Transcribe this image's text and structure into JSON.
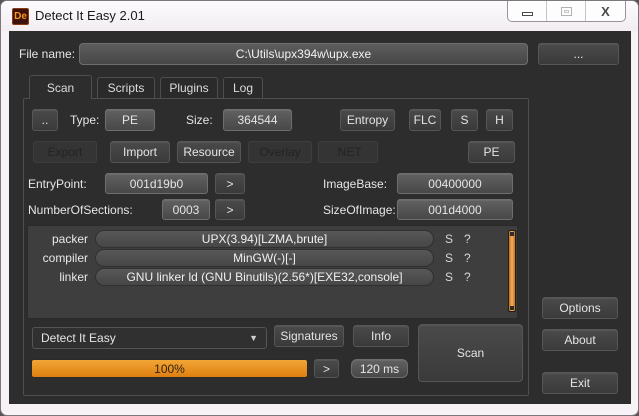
{
  "window": {
    "title": "Detect It Easy 2.01",
    "icon_glyph": "De"
  },
  "file_row": {
    "label": "File name:",
    "path": "C:\\Utils\\upx394w\\upx.exe",
    "browse_button": "..."
  },
  "tabs": [
    "Scan",
    "Scripts",
    "Plugins",
    "Log"
  ],
  "scan_tab": {
    "dots_button": "..",
    "type_label": "Type:",
    "type_value": "PE",
    "size_label": "Size:",
    "size_value": "364544",
    "entropy_button": "Entropy",
    "flc_button": "FLC",
    "s_button": "S",
    "h_button": "H",
    "export_button": "Export",
    "import_button": "Import",
    "resource_button": "Resource",
    "overlay_button": "Overlay",
    "net_button": ".NET",
    "pe_button": "PE",
    "entrypoint_label": "EntryPoint:",
    "entrypoint_value": "001d19b0",
    "goto_button": ">",
    "imagebase_label": "ImageBase:",
    "imagebase_value": "00400000",
    "numberofsections_label": "NumberOfSections:",
    "numberofsections_value": "0003",
    "sizeofimage_label": "SizeOfImage:",
    "sizeofimage_value": "001d4000",
    "results": [
      {
        "category": "packer",
        "detection": "UPX(3.94)[LZMA,brute]",
        "s_button": "S",
        "help_button": "?"
      },
      {
        "category": "compiler",
        "detection": "MinGW(-)[-]",
        "s_button": "S",
        "help_button": "?"
      },
      {
        "category": "linker",
        "detection": "GNU linker ld (GNU Binutils)(2.56*)[EXE32,console]",
        "s_button": "S",
        "help_button": "?"
      }
    ],
    "database_combo_value": "Detect It Easy",
    "signatures_button": "Signatures",
    "info_button": "Info",
    "scan_button": "Scan",
    "progress_value": "100%",
    "scan_time": "120 ms"
  },
  "side_buttons": {
    "options": "Options",
    "about": "About",
    "exit": "Exit"
  },
  "colors": {
    "accent_orange": "#e8891e",
    "client_bg": "#2d2d2d",
    "titlebar_bg": "#f7f3f7"
  }
}
